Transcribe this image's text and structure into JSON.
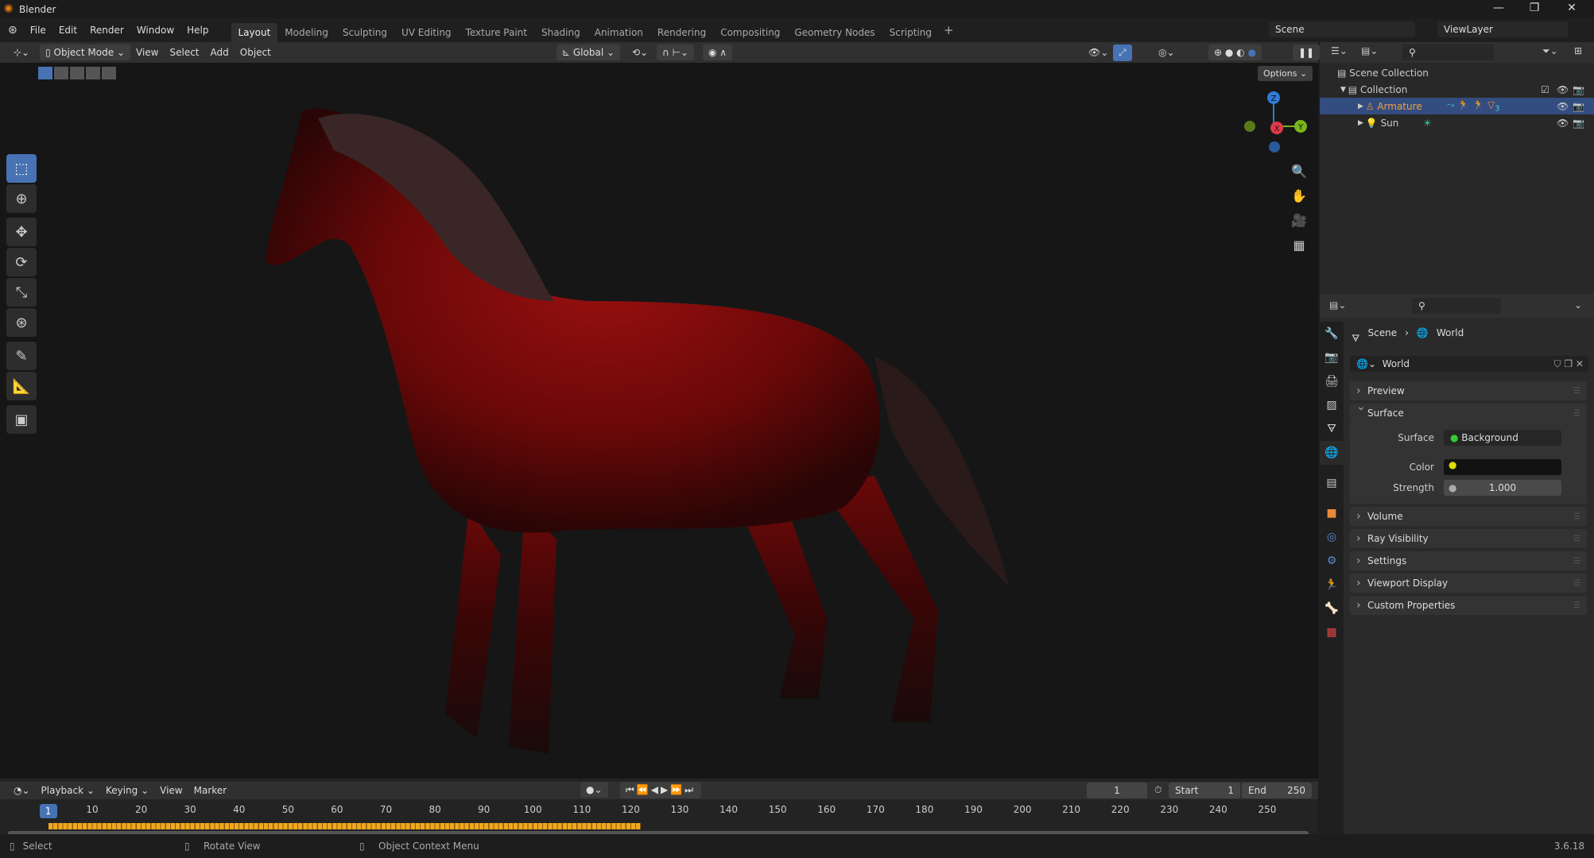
{
  "app": {
    "title": "Blender",
    "version": "3.6.18"
  },
  "menu": [
    "File",
    "Edit",
    "Render",
    "Window",
    "Help"
  ],
  "workspaces": [
    {
      "label": "Layout",
      "active": true
    },
    {
      "label": "Modeling"
    },
    {
      "label": "Sculpting"
    },
    {
      "label": "UV Editing"
    },
    {
      "label": "Texture Paint"
    },
    {
      "label": "Shading"
    },
    {
      "label": "Animation"
    },
    {
      "label": "Rendering"
    },
    {
      "label": "Compositing"
    },
    {
      "label": "Geometry Nodes"
    },
    {
      "label": "Scripting"
    }
  ],
  "scene": {
    "name": "Scene",
    "view_layer": "ViewLayer"
  },
  "viewport_header": {
    "mode": "Object Mode",
    "menus": [
      "View",
      "Select",
      "Add",
      "Object"
    ],
    "orientation": "Global",
    "options_label": "Options"
  },
  "gizmo": {
    "axes": [
      "X",
      "Y",
      "Z"
    ]
  },
  "outliner": {
    "root": "Scene Collection",
    "collection": "Collection",
    "items": [
      {
        "name": "Armature",
        "selected": true,
        "modifier_count": "3"
      },
      {
        "name": "Sun"
      }
    ]
  },
  "properties": {
    "breadcrumb": [
      "Scene",
      "World"
    ],
    "datablock": "World",
    "panels": {
      "preview": "Preview",
      "surface": "Surface",
      "volume": "Volume",
      "ray_visibility": "Ray Visibility",
      "settings": "Settings",
      "viewport_display": "Viewport Display",
      "custom_properties": "Custom Properties"
    },
    "surface_label": "Surface",
    "surface_value": "Background",
    "color_label": "Color",
    "color_value": "#121212",
    "strength_label": "Strength",
    "strength_value": "1.000"
  },
  "timeline": {
    "menus": [
      "Playback",
      "Keying",
      "View",
      "Marker"
    ],
    "current_frame": "1",
    "start_label": "Start",
    "start": "1",
    "end_label": "End",
    "end": "250",
    "ticks": [
      "1",
      "10",
      "20",
      "30",
      "40",
      "50",
      "60",
      "70",
      "80",
      "90",
      "100",
      "110",
      "120",
      "130",
      "140",
      "150",
      "160",
      "170",
      "180",
      "190",
      "200",
      "210",
      "220",
      "230",
      "240",
      "250"
    ],
    "keyframe_range": [
      1,
      122
    ]
  },
  "statusbar": {
    "select": "Select",
    "rotate": "Rotate View",
    "context": "Object Context Menu"
  },
  "colors": {
    "accent": "#4772b3",
    "keyframe": "#f0a81e",
    "horse": "#8a0e0e"
  }
}
